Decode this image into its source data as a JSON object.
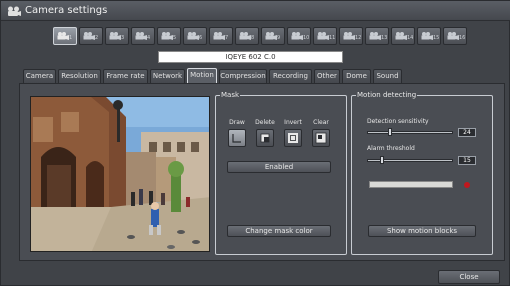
{
  "window": {
    "title": "Camera settings"
  },
  "cameras": {
    "selected_index": 0,
    "items": [
      "1",
      "2",
      "3",
      "4",
      "5",
      "6",
      "7",
      "8",
      "9",
      "10",
      "11",
      "12",
      "13",
      "14",
      "15",
      "16"
    ]
  },
  "camera_name": "IQEYE 602 C.0",
  "tabs": [
    "Camera",
    "Resolution",
    "Frame rate",
    "Network",
    "Motion",
    "Compression",
    "Recording",
    "Other",
    "Dome",
    "Sound"
  ],
  "active_tab": "Motion",
  "mask": {
    "group_label": "Mask",
    "tools": [
      "Draw",
      "Delete",
      "Invert",
      "Clear"
    ],
    "enabled_label": "Enabled",
    "change_color_label": "Change mask color"
  },
  "motion": {
    "group_label": "Motion detecting",
    "sensitivity_label": "Detection sensitivity",
    "sensitivity_value": "24",
    "sensitivity_fraction": 0.24,
    "alarm_label": "Alarm threshold",
    "alarm_value": "15",
    "alarm_fraction": 0.15,
    "indicator_color": "#c0171e",
    "show_blocks_label": "Show motion blocks"
  },
  "footer": {
    "close_label": "Close"
  }
}
